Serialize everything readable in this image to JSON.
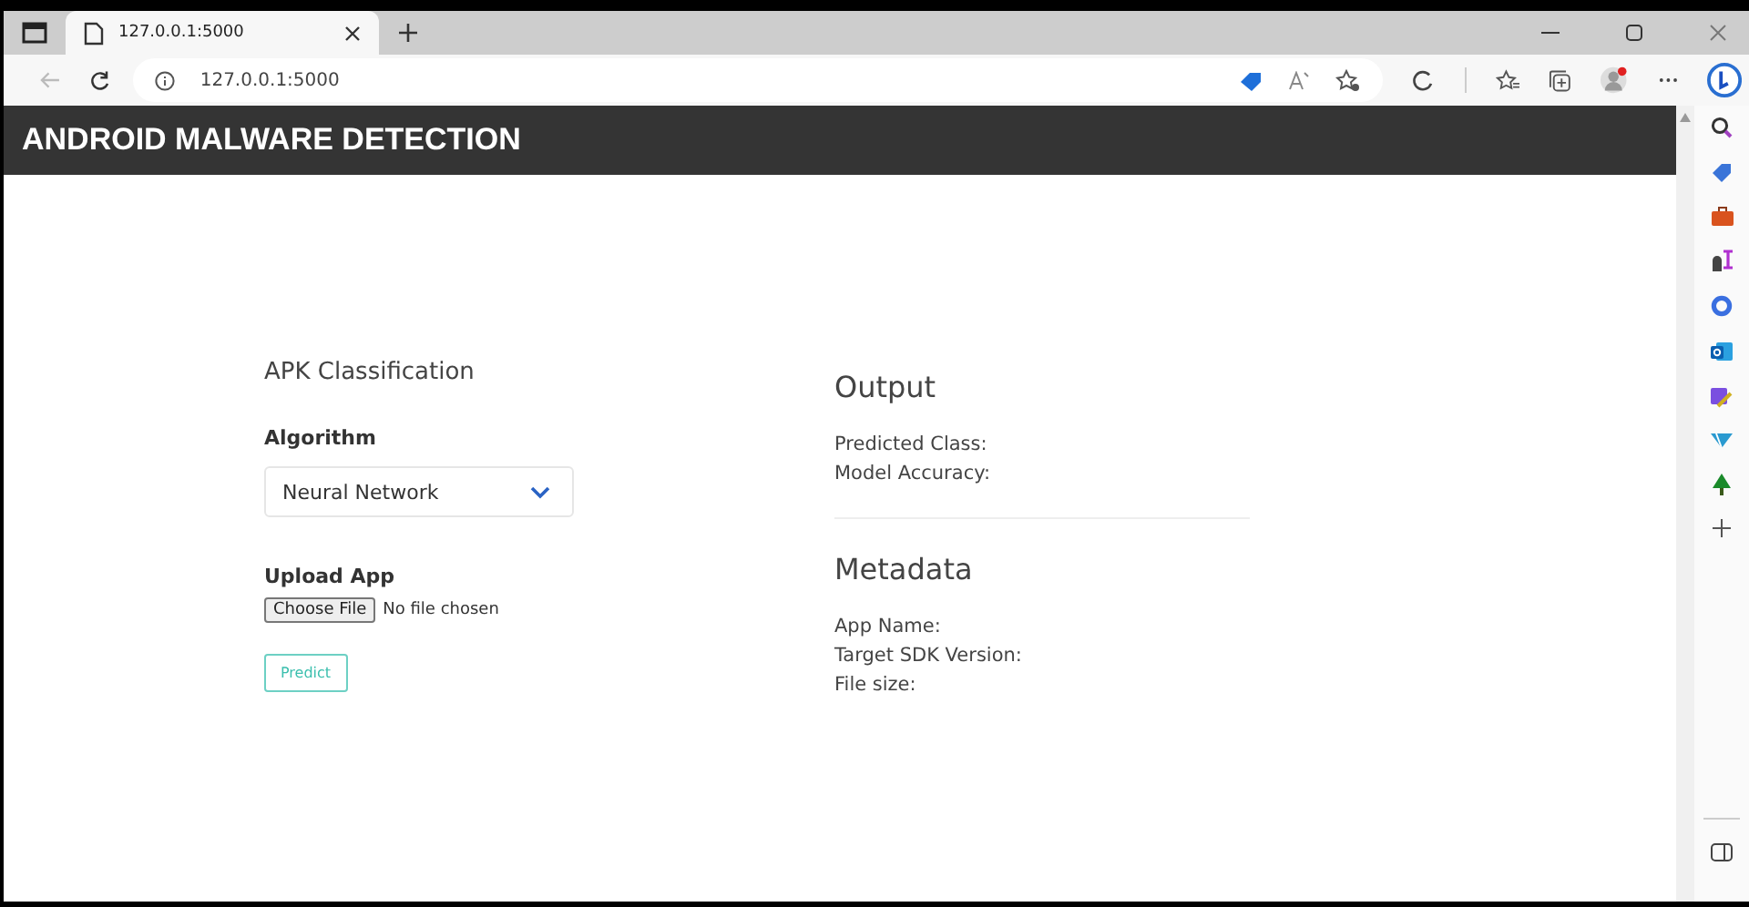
{
  "browser": {
    "tab_title": "127.0.0.1:5000",
    "address": "127.0.0.1:5000"
  },
  "header": {
    "title": "ANDROID MALWARE DETECTION"
  },
  "classification": {
    "heading": "APK Classification",
    "algorithm_label": "Algorithm",
    "algorithm_value": "Neural Network",
    "upload_label": "Upload App",
    "choose_button": "Choose File",
    "file_status": "No file chosen",
    "predict_button": "Predict"
  },
  "output": {
    "heading": "Output",
    "fields": [
      "Predicted Class:",
      "Model Accuracy:"
    ]
  },
  "metadata": {
    "heading": "Metadata",
    "fields": [
      "App Name:",
      "Target SDK Version:",
      "File size:"
    ]
  }
}
